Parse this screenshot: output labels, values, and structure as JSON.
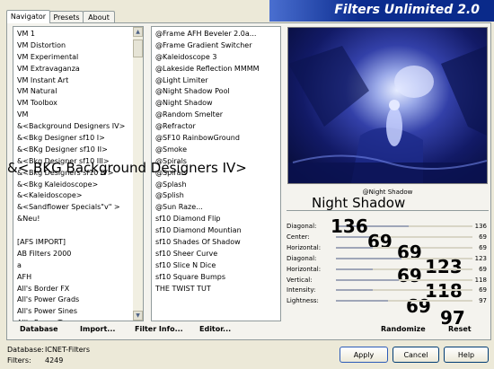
{
  "window_title": "Filters Unlimited 2.0",
  "tabs": [
    "Navigator",
    "Presets",
    "About"
  ],
  "categories": [
    "VM 1",
    "VM Distortion",
    "VM Experimental",
    "VM Extravaganza",
    "VM Instant Art",
    "VM Natural",
    "VM Toolbox",
    "VM",
    "&<Background Designers IV>",
    "&<Bkg Designer sf10 I>",
    "&<BKg Designer sf10 II>",
    "&<Bkg Designer sf10 III>",
    "&<Bkg Designers sf10 IV>",
    "&<Bkg Kaleidoscope>",
    "&<Kaleidoscope>",
    "&<Sandflower Specials\"v\" >",
    "&Neu!",
    "",
    "[AFS IMPORT]",
    "AB Filters 2000",
    "a",
    "AFH",
    "All's Border FX",
    "All's Power Grads",
    "All's Power Sines",
    "All's Power Toys"
  ],
  "filters": [
    "@Frame AFH Beveler 2.0a...",
    "@Frame Gradient Switcher",
    "@Kaleidoscope 3",
    "@Lakeside Reflection MMMM",
    "@Light Limiter",
    "@Night Shadow Pool",
    "@Night Shadow",
    "@Random Smelter",
    "@Refractor",
    "@SF10 RainbowGround",
    "@Smoke",
    "@Spirals",
    "@Spirals",
    "@Splash",
    "@Splish",
    "@Sun Raze...",
    "sf10 Diamond Flip",
    "sf10 Diamond Mountian",
    "sf10 Shades Of Shadow",
    "sf10 Sheer Curve",
    "sf10 Slice N Dice",
    "sf10 Square Bumps",
    "THE TWIST TUT"
  ],
  "overlay_category": "&< BKG Background Designers IV>",
  "filter_name": "@Night Shadow",
  "overlay_filter_name": "Night Shadow",
  "controls": [
    {
      "label": "Diagonal:",
      "value": "136",
      "big": "136",
      "level": 0.53
    },
    {
      "label": "Center:",
      "value": "69",
      "big": "69",
      "level": 0.27
    },
    {
      "label": "Horizontal:",
      "value": "69",
      "big": "69",
      "level": 0.27
    },
    {
      "label": "Diagonal:",
      "value": "123",
      "big": "123",
      "level": 0.48
    },
    {
      "label": "Horizontal:",
      "value": "69",
      "big": "69",
      "level": 0.27
    },
    {
      "label": "Vertical:",
      "value": "118",
      "big": "118",
      "level": 0.46
    },
    {
      "label": "Intensity:",
      "value": "69",
      "big": "69",
      "level": 0.27
    },
    {
      "label": "Lightness:",
      "value": "97",
      "big": "97",
      "level": 0.38
    }
  ],
  "bottom_links": {
    "database": "Database",
    "import": "Import...",
    "filter_info": "Filter Info...",
    "editor": "Editor..."
  },
  "randomize": "Randomize",
  "reset": "Reset",
  "status": {
    "db_label": "Database:",
    "db_value": "ICNET-Filters",
    "filters_label": "Filters:",
    "filters_value": "4249"
  },
  "buttons": {
    "apply": "Apply",
    "cancel": "Cancel",
    "help": "Help"
  },
  "colors": {
    "header_blue": "#0a2a8a",
    "title_text": "#ffffff",
    "bg": "#ece9d8"
  }
}
